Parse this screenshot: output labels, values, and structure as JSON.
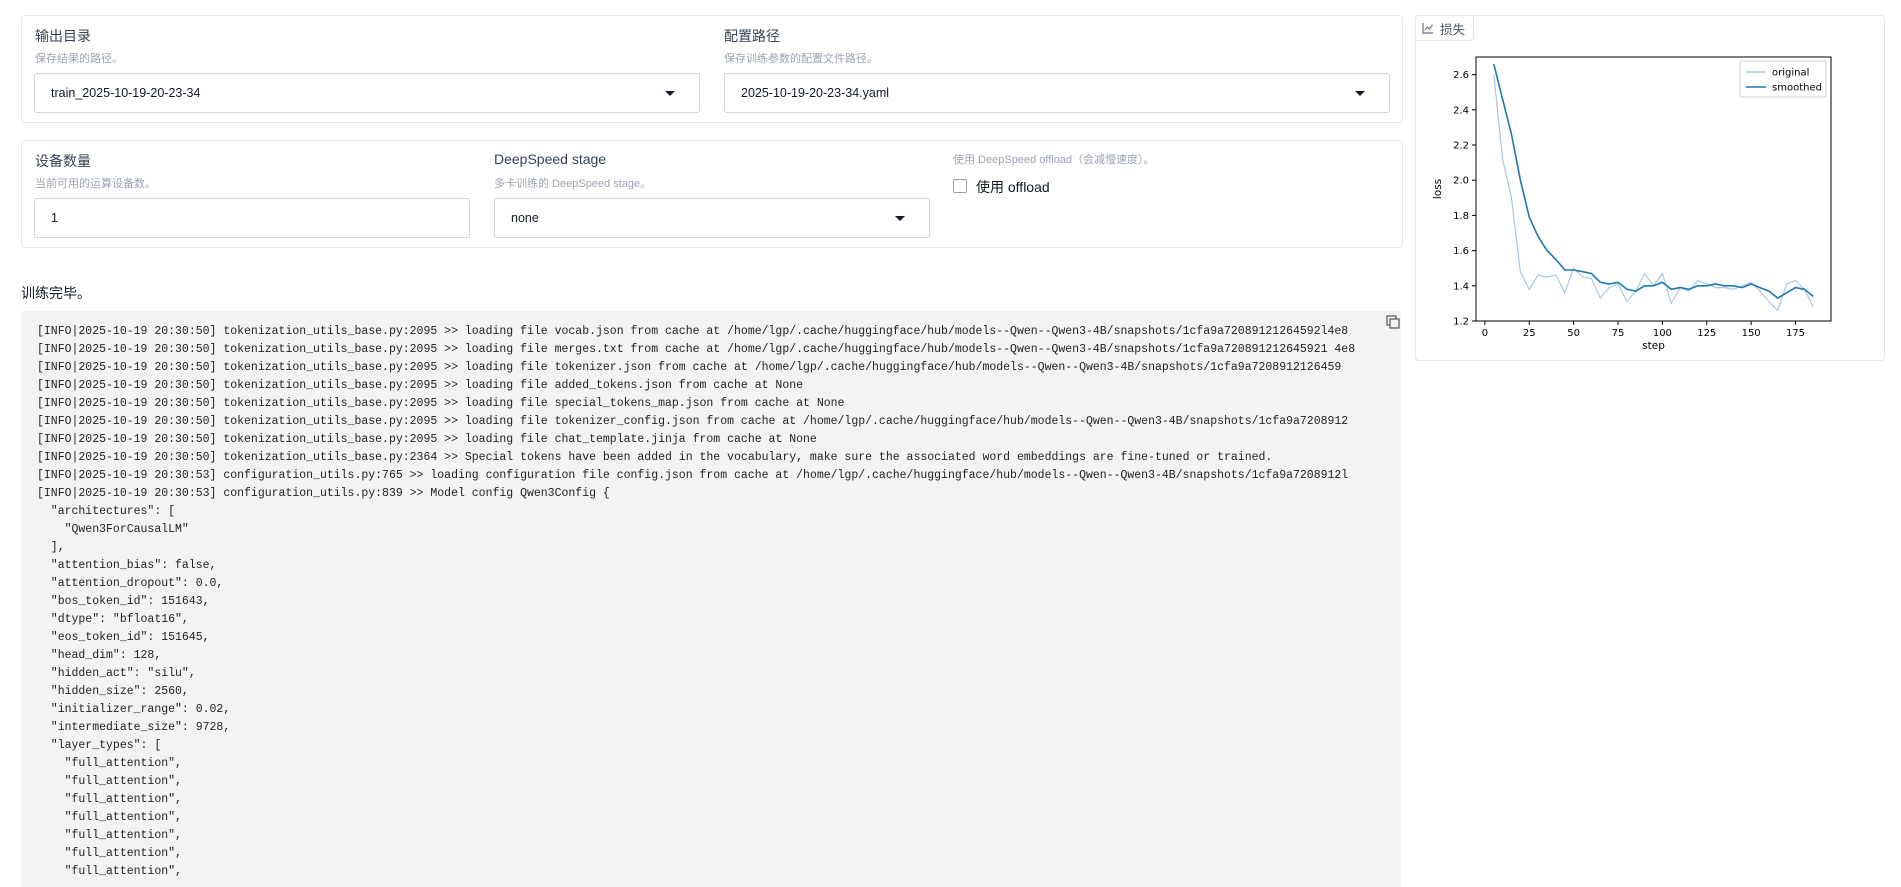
{
  "output_dir": {
    "label": "输出目录",
    "info": "保存结果的路径。",
    "value": "train_2025-10-19-20-23-34"
  },
  "config_path": {
    "label": "配置路径",
    "info": "保存训练参数的配置文件路径。",
    "value": "2025-10-19-20-23-34.yaml"
  },
  "device_count": {
    "label": "设备数量",
    "info": "当前可用的运算设备数。",
    "value": "1"
  },
  "ds_stage": {
    "label": "DeepSpeed stage",
    "info": "多卡训练的 DeepSpeed stage。",
    "value": "none"
  },
  "ds_offload": {
    "info": "使用 DeepSpeed offload（会减慢速度）。",
    "label": "使用 offload",
    "checked": false
  },
  "status_text": "训练完毕。",
  "log_lines": [
    "[INFO|2025-10-19 20:30:50] tokenization_utils_base.py:2095 >> loading file vocab.json from cache at /home/lgp/.cache/huggingface/hub/models--Qwen--Qwen3-4B/snapshots/1cfa9a72089121264592l4e8",
    "[INFO|2025-10-19 20:30:50] tokenization_utils_base.py:2095 >> loading file merges.txt from cache at /home/lgp/.cache/huggingface/hub/models--Qwen--Qwen3-4B/snapshots/1cfa9a720891212645921 4e8",
    "[INFO|2025-10-19 20:30:50] tokenization_utils_base.py:2095 >> loading file tokenizer.json from cache at /home/lgp/.cache/huggingface/hub/models--Qwen--Qwen3-4B/snapshots/1cfa9a7208912126459",
    "[INFO|2025-10-19 20:30:50] tokenization_utils_base.py:2095 >> loading file added_tokens.json from cache at None",
    "[INFO|2025-10-19 20:30:50] tokenization_utils_base.py:2095 >> loading file special_tokens_map.json from cache at None",
    "[INFO|2025-10-19 20:30:50] tokenization_utils_base.py:2095 >> loading file tokenizer_config.json from cache at /home/lgp/.cache/huggingface/hub/models--Qwen--Qwen3-4B/snapshots/1cfa9a7208912",
    "[INFO|2025-10-19 20:30:50] tokenization_utils_base.py:2095 >> loading file chat_template.jinja from cache at None",
    "[INFO|2025-10-19 20:30:50] tokenization_utils_base.py:2364 >> Special tokens have been added in the vocabulary, make sure the associated word embeddings are fine-tuned or trained.",
    "[INFO|2025-10-19 20:30:53] configuration_utils.py:765 >> loading configuration file config.json from cache at /home/lgp/.cache/huggingface/hub/models--Qwen--Qwen3-4B/snapshots/1cfa9a7208912l",
    "[INFO|2025-10-19 20:30:53] configuration_utils.py:839 >> Model config Qwen3Config {",
    "  \"architectures\": [",
    "    \"Qwen3ForCausalLM\"",
    "  ],",
    "  \"attention_bias\": false,",
    "  \"attention_dropout\": 0.0,",
    "  \"bos_token_id\": 151643,",
    "  \"dtype\": \"bfloat16\",",
    "  \"eos_token_id\": 151645,",
    "  \"head_dim\": 128,",
    "  \"hidden_act\": \"silu\",",
    "  \"hidden_size\": 2560,",
    "  \"initializer_range\": 0.02,",
    "  \"intermediate_size\": 9728,",
    "  \"layer_types\": [",
    "    \"full_attention\",",
    "    \"full_attention\",",
    "    \"full_attention\",",
    "    \"full_attention\",",
    "    \"full_attention\",",
    "    \"full_attention\",",
    "    \"full_attention\","
  ],
  "plot": {
    "tab_label": "损失",
    "icon": "chart-icon"
  },
  "chart_data": {
    "type": "line",
    "title": "",
    "xlabel": "step",
    "ylabel": "loss",
    "xlim": [
      -5,
      195
    ],
    "ylim": [
      1.2,
      2.7
    ],
    "xticks": [
      0,
      25,
      50,
      75,
      100,
      125,
      150,
      175
    ],
    "yticks": [
      1.2,
      1.4,
      1.6,
      1.8,
      2.0,
      2.2,
      2.4,
      2.6
    ],
    "legend_position": "top-right",
    "grid": false,
    "series": [
      {
        "name": "original",
        "color": "#a6c8e3",
        "x": [
          5,
          10,
          15,
          20,
          25,
          30,
          35,
          40,
          45,
          50,
          55,
          60,
          65,
          70,
          75,
          80,
          85,
          90,
          95,
          100,
          105,
          110,
          115,
          120,
          125,
          130,
          135,
          140,
          145,
          150,
          155,
          160,
          165,
          170,
          175,
          180,
          185
        ],
        "y": [
          2.6,
          2.12,
          1.9,
          1.48,
          1.38,
          1.46,
          1.45,
          1.46,
          1.36,
          1.5,
          1.45,
          1.44,
          1.33,
          1.39,
          1.41,
          1.31,
          1.37,
          1.47,
          1.4,
          1.47,
          1.3,
          1.39,
          1.37,
          1.43,
          1.41,
          1.39,
          1.39,
          1.38,
          1.4,
          1.42,
          1.37,
          1.31,
          1.26,
          1.41,
          1.43,
          1.38,
          1.28
        ]
      },
      {
        "name": "smoothed",
        "color": "#1f77b4",
        "x": [
          5,
          10,
          15,
          20,
          25,
          30,
          35,
          40,
          45,
          50,
          55,
          60,
          65,
          70,
          75,
          80,
          85,
          90,
          95,
          100,
          105,
          110,
          115,
          120,
          125,
          130,
          135,
          140,
          145,
          150,
          155,
          160,
          165,
          170,
          175,
          180,
          185
        ],
        "y": [
          2.66,
          2.46,
          2.26,
          2.0,
          1.79,
          1.68,
          1.6,
          1.55,
          1.49,
          1.49,
          1.48,
          1.47,
          1.42,
          1.41,
          1.42,
          1.38,
          1.37,
          1.4,
          1.4,
          1.42,
          1.38,
          1.39,
          1.38,
          1.4,
          1.4,
          1.41,
          1.4,
          1.4,
          1.39,
          1.41,
          1.39,
          1.37,
          1.33,
          1.36,
          1.39,
          1.38,
          1.34
        ]
      }
    ]
  }
}
